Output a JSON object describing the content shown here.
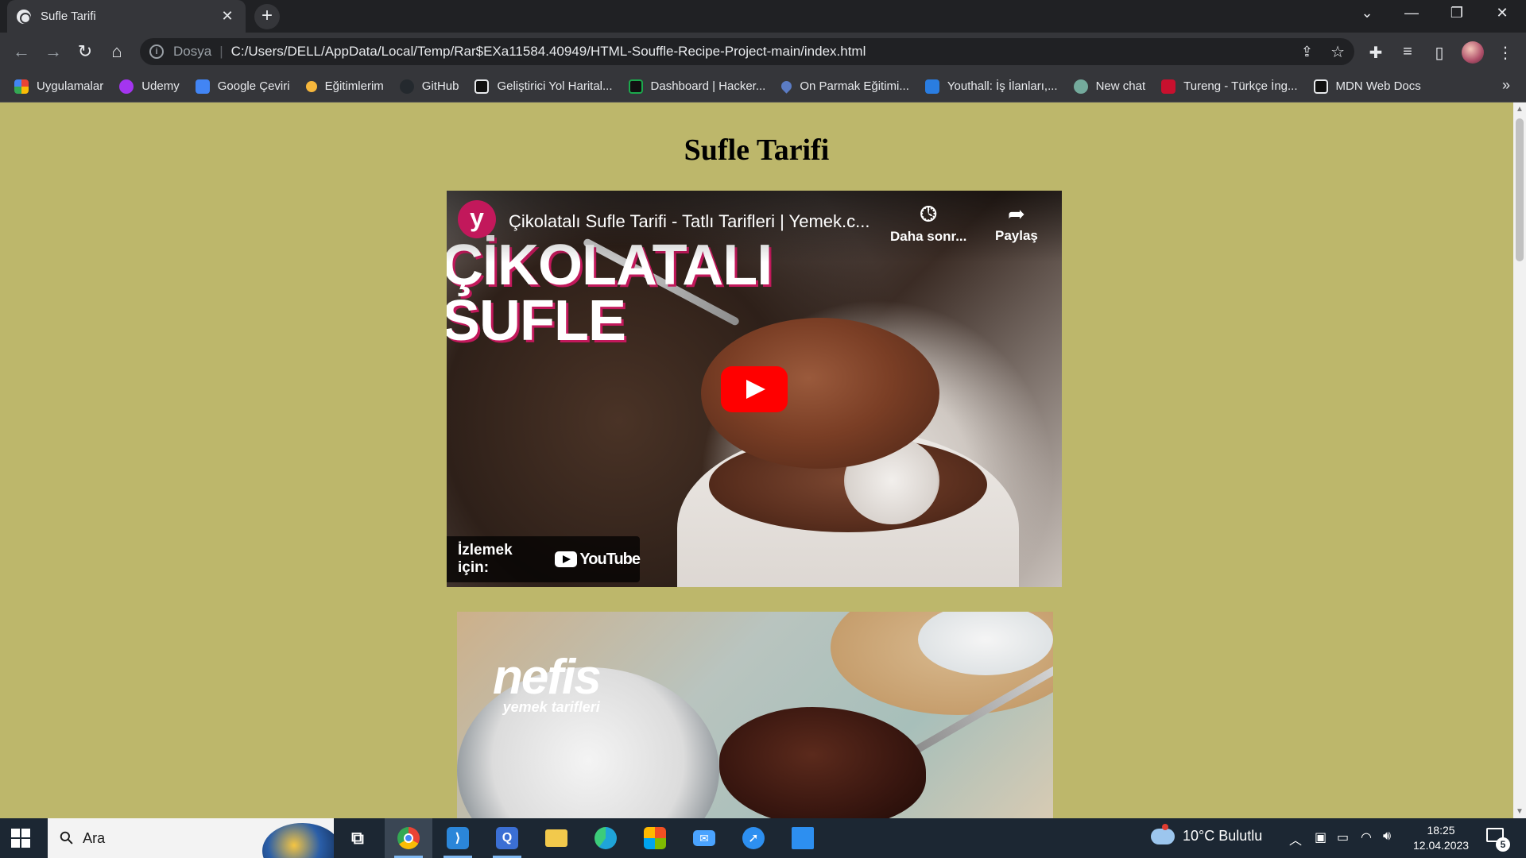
{
  "browser": {
    "tab_title": "Sufle Tarifi",
    "tab_close": "✕",
    "new_tab": "+",
    "omnibox": {
      "scheme_label": "Dosya",
      "url": "C:/Users/DELL/AppData/Local/Temp/Rar$EXa11584.40949/HTML-Souffle-Recipe-Project-main/index.html"
    },
    "bookmarks": [
      {
        "label": "Uygulamalar",
        "icon": "apps-grid-icon",
        "color": "#ea4335"
      },
      {
        "label": "Udemy",
        "icon": "udemy-icon",
        "color": "#a435f0"
      },
      {
        "label": "Google Çeviri",
        "icon": "google-translate-icon",
        "color": "#4285f4"
      },
      {
        "label": "Eğitimlerim",
        "icon": "circle-icon",
        "color": "#f6b73c"
      },
      {
        "label": "GitHub",
        "icon": "github-icon",
        "color": "#24292e"
      },
      {
        "label": "Geliştirici Yol Harital...",
        "icon": "roadmap-icon",
        "color": "#111111"
      },
      {
        "label": "Dashboard | Hacker...",
        "icon": "hackerrank-icon",
        "color": "#111111"
      },
      {
        "label": "On Parmak Eğitimi...",
        "icon": "drop-icon",
        "color": "#5b7cc4"
      },
      {
        "label": "Youthall: İş İlanları,...",
        "icon": "youthall-icon",
        "color": "#2a7de1"
      },
      {
        "label": "New chat",
        "icon": "chatgpt-icon",
        "color": "#74aa9c"
      },
      {
        "label": "Tureng - Türkçe İng...",
        "icon": "tureng-icon",
        "color": "#c8102e"
      },
      {
        "label": "MDN Web Docs",
        "icon": "mdn-icon",
        "color": "#111111"
      }
    ],
    "bookmarks_more": "»"
  },
  "page": {
    "title": "Sufle Tarifi",
    "video": {
      "channel_logo_letter": "y",
      "title": "Çikolatalı Sufle Tarifi - Tatlı Tarifleri | Yemek.c...",
      "thumbnail_text_line1": "ÇİKOLATALI",
      "thumbnail_text_line2": "SUFLE",
      "watch_later": "Daha sonr...",
      "share": "Paylaş",
      "watch_on": "İzlemek için:",
      "youtube_word": "YouTube"
    },
    "photo": {
      "watermark_brand": "nefis",
      "watermark_sub": "yemek tarifleri"
    }
  },
  "taskbar": {
    "search_placeholder": "Ara",
    "apps": [
      {
        "name": "task-view",
        "glyph": "⧉",
        "color": "#ffffff"
      },
      {
        "name": "chrome",
        "glyph": "●",
        "color": "#34a853",
        "active": true
      },
      {
        "name": "vscode",
        "glyph": "◢",
        "color": "#2b86d9"
      },
      {
        "name": "qt-creator",
        "glyph": "Q",
        "color": "#3b6fd4"
      },
      {
        "name": "file-explorer",
        "glyph": "▬",
        "color": "#f2c94c"
      },
      {
        "name": "edge",
        "glyph": "e",
        "color": "#1fa4d8"
      },
      {
        "name": "store",
        "glyph": "▦",
        "color": "#4aa3ff"
      },
      {
        "name": "mail",
        "glyph": "✉",
        "color": "#4aa3ff"
      },
      {
        "name": "app-blue",
        "glyph": "◐",
        "color": "#2d8ff0"
      },
      {
        "name": "app-square",
        "glyph": "■",
        "color": "#2d8ff0"
      }
    ],
    "weather": "10°C  Bulutlu",
    "time": "18:25",
    "date": "12.04.2023",
    "notification_count": "5"
  }
}
